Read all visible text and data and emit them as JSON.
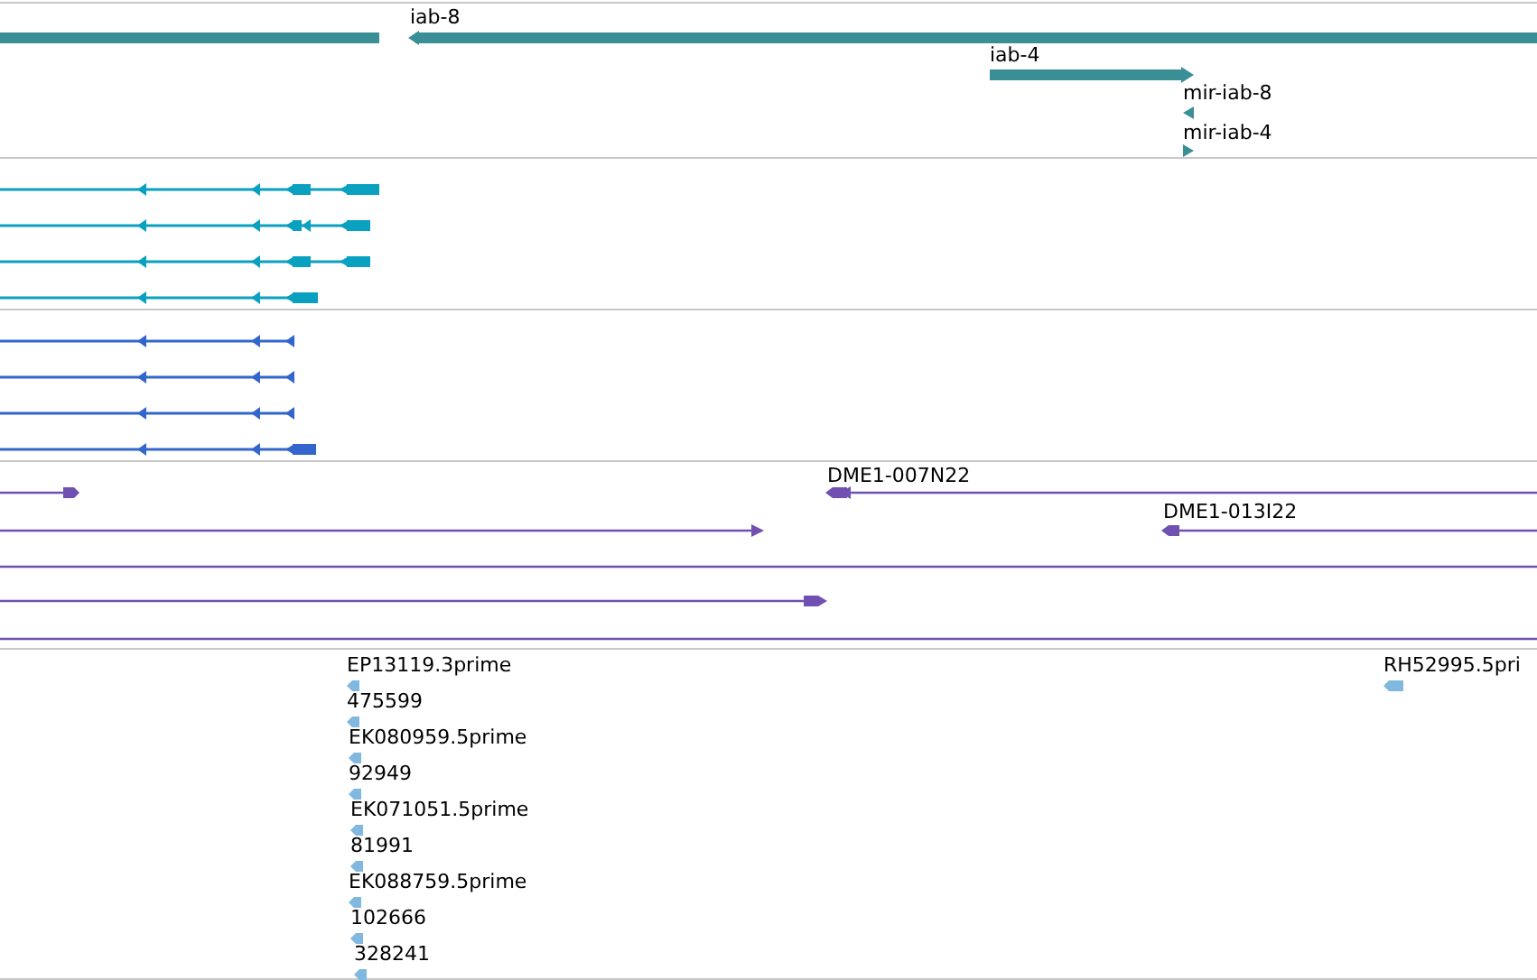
{
  "tracks": [
    {
      "kind": "gene",
      "color": "#3a8f96",
      "features": [
        {
          "label": "iab-8"
        },
        {
          "label": "iab-4"
        },
        {
          "label": "mir-iab-8"
        },
        {
          "label": "mir-iab-4"
        }
      ]
    },
    {
      "kind": "transcript",
      "color": "#0aa0c0"
    },
    {
      "kind": "transcript",
      "color": "#3366cc"
    },
    {
      "kind": "clone",
      "color": "#7050b0",
      "features": [
        {
          "label": "DME1-007N22"
        },
        {
          "label": "DME1-013I22"
        }
      ]
    },
    {
      "kind": "est",
      "color": "#80b8e0",
      "features": [
        {
          "label": "EP13119.3prime"
        },
        {
          "label": "475599"
        },
        {
          "label": "EK080959.5prime"
        },
        {
          "label": "92949"
        },
        {
          "label": "EK071051.5prime"
        },
        {
          "label": "81991"
        },
        {
          "label": "EK088759.5prime"
        },
        {
          "label": "102666"
        },
        {
          "label": "328241"
        },
        {
          "label": "RH52995.5pri"
        }
      ]
    }
  ]
}
